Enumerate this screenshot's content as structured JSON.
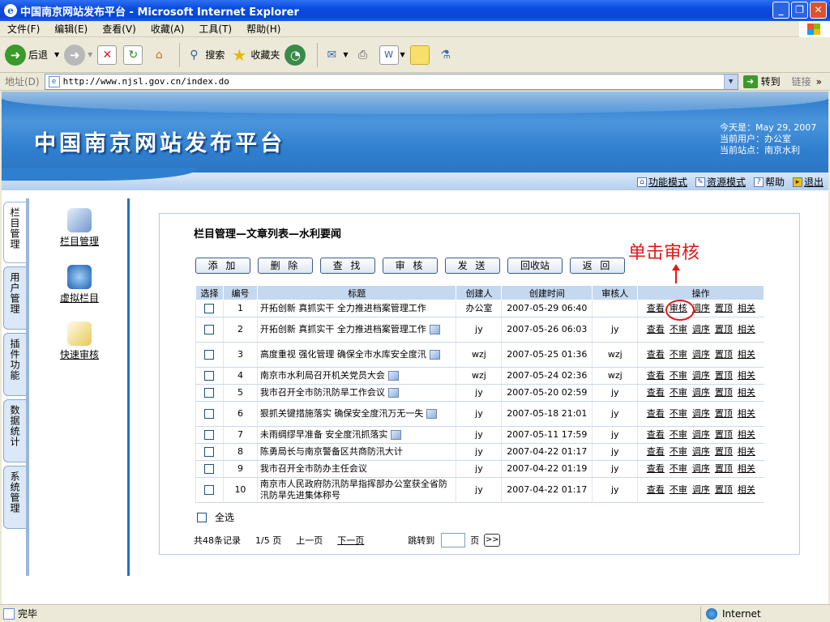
{
  "window": {
    "title": "中国南京网站发布平台 - Microsoft Internet Explorer",
    "controls": [
      "minimize",
      "restore",
      "close"
    ]
  },
  "menu": [
    "文件(F)",
    "编辑(E)",
    "查看(V)",
    "收藏(A)",
    "工具(T)",
    "帮助(H)"
  ],
  "toolbar": {
    "back": "后退",
    "search": "搜索",
    "favorites": "收藏夹",
    "icons": [
      "back-icon",
      "forward-icon",
      "stop-icon",
      "refresh-icon",
      "home-icon",
      "search-icon",
      "favorites-icon",
      "history-icon",
      "mail-icon",
      "print-icon",
      "edit-icon",
      "discuss-icon",
      "research-icon"
    ]
  },
  "address": {
    "label": "地址(D)",
    "url": "http://www.njsl.gov.cn/index.do",
    "go": "转到",
    "links": "链接"
  },
  "banner": {
    "title": "中国南京网站发布平台",
    "today": "今天是：May 29, 2007",
    "user": "当前用户：办公室",
    "site": "当前站点：南京水利"
  },
  "modes": {
    "function_mode": "功能模式",
    "resource_mode": "资源模式",
    "help": "帮助",
    "logout": "退出"
  },
  "side_tabs": [
    "栏目管理",
    "用户管理",
    "插件功能",
    "数据统计",
    "系统管理"
  ],
  "side_items": [
    "栏目管理",
    "虚拟栏目",
    "快速审核"
  ],
  "panel": {
    "title": "栏目管理—文章列表—水利要闻",
    "annotation": "单击审核",
    "buttons": [
      "添 加",
      "删 除",
      "查 找",
      "审 核",
      "发 送",
      "回收站",
      "返 回"
    ]
  },
  "table": {
    "headers": [
      "选择",
      "编号",
      "标题",
      "创建人",
      "创建时间",
      "审核人",
      "操作"
    ],
    "rows": [
      {
        "no": "1",
        "title": "开拓创新 真抓实干 全力推进档案管理工作",
        "img": false,
        "creator": "办公室",
        "time": "2007-05-29 06:40",
        "reviewer": "",
        "review_op": "审核"
      },
      {
        "no": "2",
        "title": "开拓创新 真抓实干 全力推进档案管理工作",
        "img": true,
        "creator": "jy",
        "time": "2007-05-26 06:03",
        "reviewer": "jy",
        "review_op": "不审"
      },
      {
        "no": "3",
        "title": "高度重视 强化管理 确保全市水库安全度汛",
        "img": true,
        "creator": "wzj",
        "time": "2007-05-25 01:36",
        "reviewer": "wzj",
        "review_op": "不审"
      },
      {
        "no": "4",
        "title": "南京市水利局召开机关党员大会",
        "img": true,
        "creator": "wzj",
        "time": "2007-05-24 02:36",
        "reviewer": "wzj",
        "review_op": "不审"
      },
      {
        "no": "5",
        "title": "我市召开全市防汛防旱工作会议",
        "img": true,
        "creator": "jy",
        "time": "2007-05-20 02:59",
        "reviewer": "jy",
        "review_op": "不审"
      },
      {
        "no": "6",
        "title": "狠抓关键措施落实 确保安全度汛万无一失",
        "img": true,
        "creator": "jy",
        "time": "2007-05-18 21:01",
        "reviewer": "jy",
        "review_op": "不审"
      },
      {
        "no": "7",
        "title": "未雨绸缪早准备 安全度汛抓落实",
        "img": true,
        "creator": "jy",
        "time": "2007-05-11 17:59",
        "reviewer": "jy",
        "review_op": "不审"
      },
      {
        "no": "8",
        "title": "陈勇局长与南京警备区共商防汛大计",
        "img": false,
        "creator": "jy",
        "time": "2007-04-22 01:17",
        "reviewer": "jy",
        "review_op": "不审"
      },
      {
        "no": "9",
        "title": "我市召开全市防办主任会议",
        "img": false,
        "creator": "jy",
        "time": "2007-04-22 01:19",
        "reviewer": "jy",
        "review_op": "不审"
      },
      {
        "no": "10",
        "title": "南京市人民政府防汛防旱指挥部办公室获全省防汛防旱先进集体称号",
        "img": false,
        "creator": "jy",
        "time": "2007-04-22 01:17",
        "reviewer": "jy",
        "review_op": "不审"
      }
    ],
    "ops": [
      "查看",
      "调序",
      "置顶",
      "相关"
    ]
  },
  "footer": {
    "select_all": "全选",
    "total": "共48条记录",
    "page": "1/5 页",
    "prev": "上一页",
    "next": "下一页",
    "jump": "跳转到",
    "page_unit": "页",
    "go": ">>"
  },
  "status": {
    "text": "完毕",
    "zone": "Internet"
  },
  "colors": {
    "title_bar": "#0a4be0",
    "banner": "#2f7fcf",
    "table_header": "#c4d8f0",
    "annotation": "#e31818"
  }
}
